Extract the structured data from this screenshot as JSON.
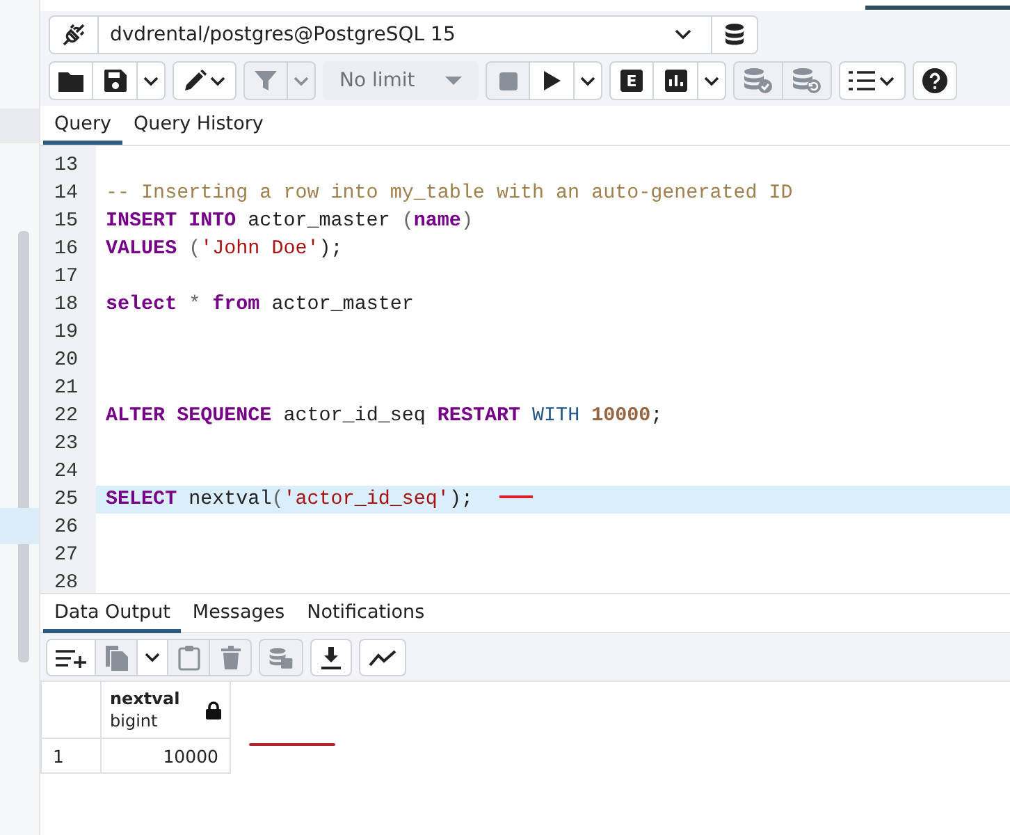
{
  "connection": {
    "label": "dvdrental/postgres@PostgreSQL 15"
  },
  "toolbar": {
    "groups": [
      {
        "buttons": [
          {
            "kind": "open",
            "disabled": false
          },
          {
            "kind": "save",
            "disabled": false
          },
          {
            "kind": "caret",
            "disabled": false
          }
        ]
      },
      {
        "buttons": [
          {
            "kind": "edit",
            "disabled": false
          }
        ]
      },
      {
        "buttons": [
          {
            "kind": "filter",
            "disabled": true
          },
          {
            "kind": "caret",
            "disabled": true
          }
        ]
      },
      {
        "buttons": [
          {
            "kind": "select",
            "label": "No limit",
            "disabled": true
          }
        ]
      },
      {
        "buttons": [
          {
            "kind": "stop",
            "disabled": true
          },
          {
            "kind": "play",
            "disabled": false
          },
          {
            "kind": "caret",
            "disabled": false
          }
        ]
      },
      {
        "buttons": [
          {
            "kind": "explain",
            "label": "E",
            "disabled": false
          },
          {
            "kind": "chart",
            "disabled": false
          },
          {
            "kind": "caret",
            "disabled": false
          }
        ]
      },
      {
        "buttons": [
          {
            "kind": "commit",
            "disabled": true
          },
          {
            "kind": "rollback",
            "disabled": true
          }
        ]
      },
      {
        "buttons": [
          {
            "kind": "macros",
            "disabled": false
          }
        ]
      },
      {
        "buttons": [
          {
            "kind": "help",
            "disabled": false
          }
        ]
      }
    ]
  },
  "editor_tabs": [
    {
      "label": "Query",
      "selected": true
    },
    {
      "label": "Query History",
      "selected": false
    }
  ],
  "editor": {
    "lines": [
      {
        "number": "13",
        "selected": false
      },
      {
        "number": "14",
        "selected": false,
        "tokens": [
          {
            "kind": "comment",
            "text": "-- Inserting a row into my_table with an auto-generated ID"
          }
        ]
      },
      {
        "number": "15",
        "selected": false,
        "tokens": [
          {
            "kind": "keyword",
            "text": "INSERT INTO"
          },
          {
            "kind": "plain",
            "text": " actor_master "
          },
          {
            "kind": "punct",
            "text": "("
          },
          {
            "kind": "keyword",
            "text": "name"
          },
          {
            "kind": "punct",
            "text": ")"
          }
        ]
      },
      {
        "number": "16",
        "selected": false,
        "tokens": [
          {
            "kind": "keyword",
            "text": "VALUES"
          },
          {
            "kind": "punct",
            "text": " ("
          },
          {
            "kind": "string",
            "text": "'John Doe'"
          },
          {
            "kind": "plain",
            "text": ");"
          }
        ]
      },
      {
        "number": "17",
        "selected": false
      },
      {
        "number": "18",
        "selected": false,
        "tokens": [
          {
            "kind": "keyword",
            "text": "select"
          },
          {
            "kind": "punct",
            "text": " * "
          },
          {
            "kind": "keyword",
            "text": "from"
          },
          {
            "kind": "plain",
            "text": " actor_master"
          }
        ]
      },
      {
        "number": "19",
        "selected": false
      },
      {
        "number": "20",
        "selected": false
      },
      {
        "number": "21",
        "selected": false
      },
      {
        "number": "22",
        "selected": false,
        "tokens": [
          {
            "kind": "keyword",
            "text": "ALTER SEQUENCE"
          },
          {
            "kind": "plain",
            "text": " actor_id_seq "
          },
          {
            "kind": "keyword",
            "text": "RESTART"
          },
          {
            "kind": "builtin",
            "text": " WITH "
          },
          {
            "kind": "number",
            "text": "10000"
          },
          {
            "kind": "plain",
            "text": ";"
          }
        ]
      },
      {
        "number": "23",
        "selected": false
      },
      {
        "number": "24",
        "selected": false
      },
      {
        "number": "25",
        "selected": true,
        "tokens": [
          {
            "kind": "keyword",
            "text": "SELECT"
          },
          {
            "kind": "plain",
            "text": " nextval"
          },
          {
            "kind": "punct",
            "text": "("
          },
          {
            "kind": "string",
            "text": "'actor_id_seq'"
          },
          {
            "kind": "plain",
            "text": ");"
          }
        ]
      },
      {
        "number": "26",
        "selected": false
      },
      {
        "number": "27",
        "selected": false
      },
      {
        "number": "28",
        "selected": false
      }
    ]
  },
  "result_tabs": [
    {
      "label": "Data Output",
      "selected": true
    },
    {
      "label": "Messages",
      "selected": false
    },
    {
      "label": "Notifications",
      "selected": false
    }
  ],
  "result_toolbar": {
    "groups": [
      {
        "buttons": [
          {
            "kind": "add-row",
            "disabled": false
          },
          {
            "kind": "copy",
            "disabled": true
          },
          {
            "kind": "caret",
            "disabled": false
          },
          {
            "kind": "paste",
            "disabled": true
          },
          {
            "kind": "delete",
            "disabled": true
          }
        ]
      },
      {
        "buttons": [
          {
            "kind": "save-data",
            "disabled": true
          }
        ]
      },
      {
        "buttons": [
          {
            "kind": "download",
            "disabled": false
          }
        ]
      },
      {
        "buttons": [
          {
            "kind": "graph",
            "disabled": false
          }
        ]
      }
    ]
  },
  "grid": {
    "columns": [
      {
        "name": "nextval",
        "type": "bigint",
        "locked": true
      }
    ],
    "rows": [
      {
        "number": "1",
        "cells": [
          "10000"
        ]
      }
    ]
  }
}
